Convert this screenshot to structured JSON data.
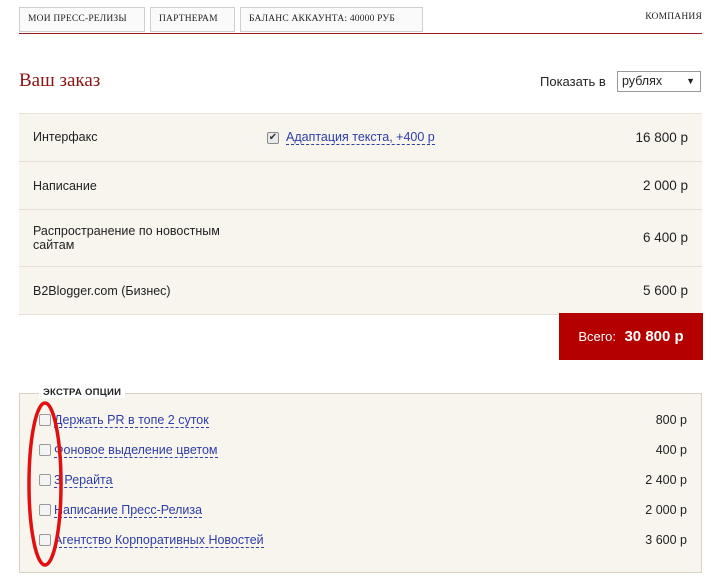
{
  "nav": {
    "items": [
      "МОИ ПРЕСС-РЕЛИЗЫ",
      "ПАРТНЕРАМ",
      "БАЛАНС АККАУНТА: 40000 РУБ"
    ],
    "right": "КОМПАНИЯ"
  },
  "order": {
    "title": "Ваш заказ",
    "currency_label": "Показать в",
    "currency_value": "рублях",
    "rows": [
      {
        "name": "Интерфакс",
        "addon": "Адаптация текста, +400 р",
        "price": "16 800 р"
      },
      {
        "name": "Написание",
        "price": "2 000 р"
      },
      {
        "name": "Распространение по новостным сайтам",
        "price": "6 400 р"
      },
      {
        "name": "B2Blogger.com (Бизнес)",
        "price": "5 600 р"
      }
    ],
    "total_label": "Всего:",
    "total_value": "30 800 р"
  },
  "extras": {
    "title": "ЭКСТРА ОПЦИИ",
    "items": [
      {
        "label": "Держать PR в топе 2 суток",
        "price": "800 р"
      },
      {
        "label": "Фоновое выделение цветом",
        "price": "400 р"
      },
      {
        "label": "3 Рерайта",
        "price": "2 400 р"
      },
      {
        "label": "Написание Пресс-Релиза",
        "price": "2 000 р"
      },
      {
        "label": "Агентство Корпоративных Новостей",
        "price": "3 600 р"
      }
    ]
  },
  "colors": {
    "accent": "#8b1414",
    "total_bg": "#b50000",
    "link": "#2d3ea8",
    "panel_bg": "#f8f5ef"
  }
}
